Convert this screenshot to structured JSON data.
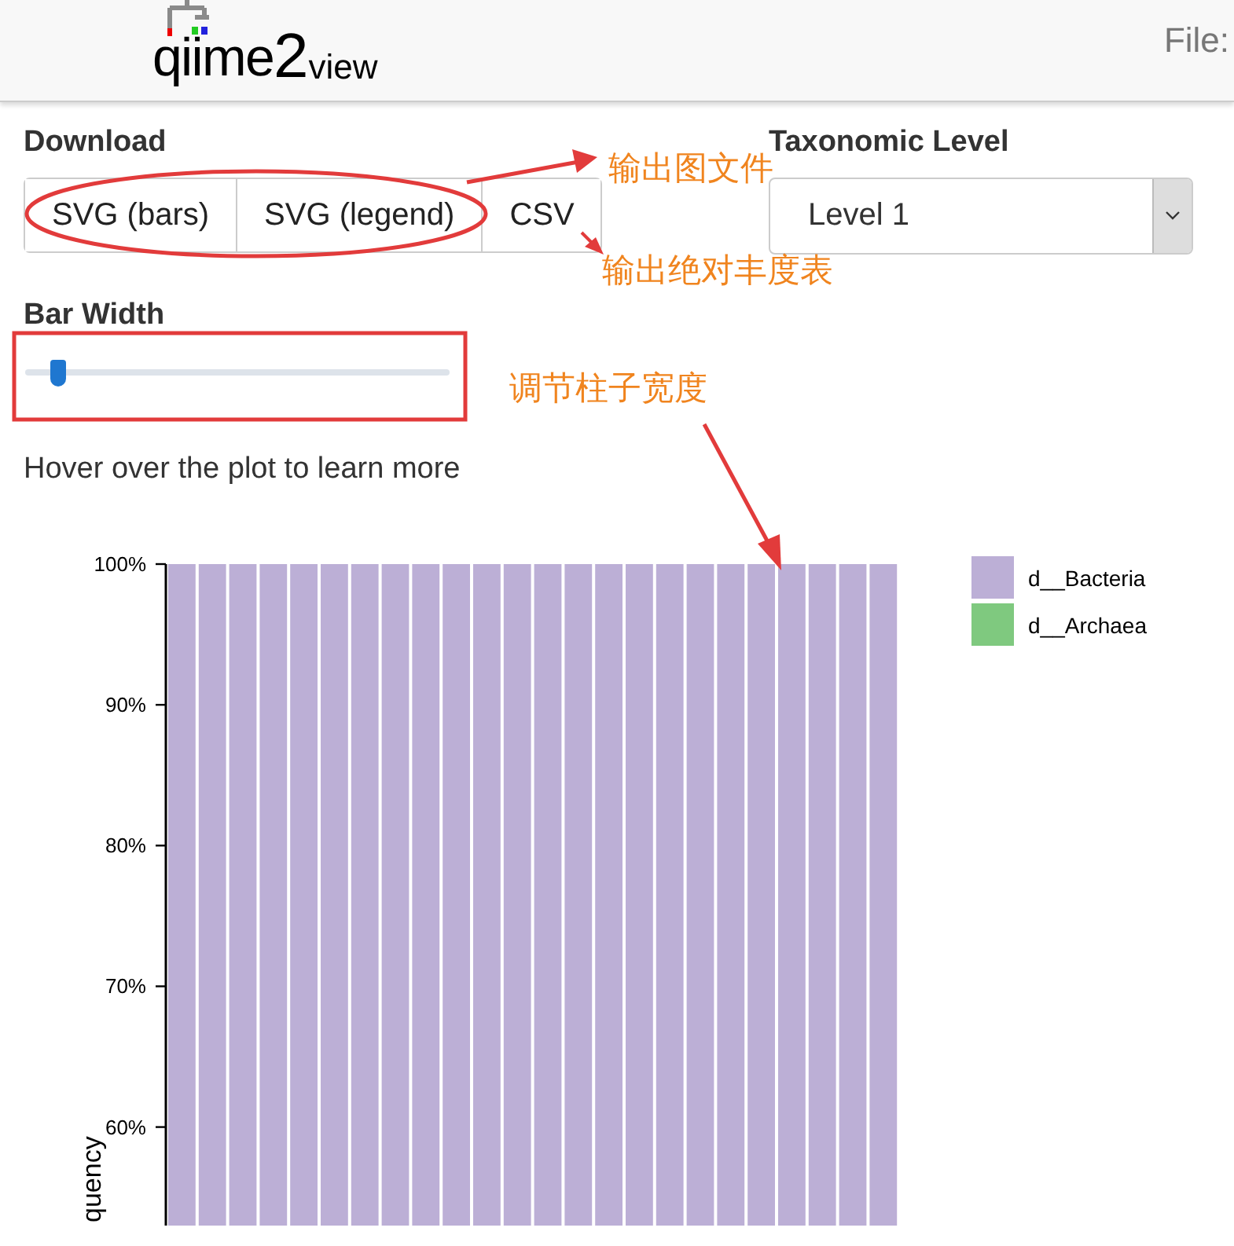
{
  "header": {
    "logo": {
      "name": "qiime",
      "number": "2",
      "suffix": "view"
    },
    "file_label": "File:"
  },
  "download": {
    "label": "Download",
    "buttons": [
      "SVG (bars)",
      "SVG (legend)",
      "CSV"
    ]
  },
  "taxonomic_level": {
    "label": "Taxonomic Level",
    "value": "Level 1"
  },
  "bar_width": {
    "label": "Bar Width",
    "level": 0.06
  },
  "hint": "Hover over the plot to learn more",
  "plot": {
    "chart_data": {
      "type": "bar",
      "stacked": true,
      "ylabel": "quency",
      "ylim": [
        53,
        100
      ],
      "series": [
        {
          "name": "d__Bacteria",
          "color": "#bcafd6",
          "values": [
            100,
            100,
            100,
            100,
            100,
            100,
            100,
            100,
            100,
            100,
            100,
            100,
            100,
            100,
            100,
            100,
            100,
            100,
            100,
            100,
            100,
            100,
            100,
            100
          ]
        },
        {
          "name": "d__Archaea",
          "color": "#7fc97f",
          "values": [
            null,
            null,
            null,
            null,
            null,
            null,
            null,
            null,
            null,
            null,
            null,
            null,
            null,
            null,
            null,
            null,
            null,
            null,
            null,
            null,
            null,
            null,
            null,
            null
          ]
        }
      ],
      "yticks": [
        {
          "value": 60,
          "label": "60%"
        },
        {
          "value": 70,
          "label": "70%"
        },
        {
          "value": 80,
          "label": "80%"
        },
        {
          "value": 90,
          "label": "90%"
        },
        {
          "value": 100,
          "label": "100%"
        }
      ]
    }
  },
  "annotations": [
    {
      "kind": "export_figure",
      "text": "输出图文件"
    },
    {
      "kind": "export_table",
      "text": "输出绝对丰度表"
    },
    {
      "kind": "bar_width",
      "text": "调节柱子宽度"
    }
  ]
}
